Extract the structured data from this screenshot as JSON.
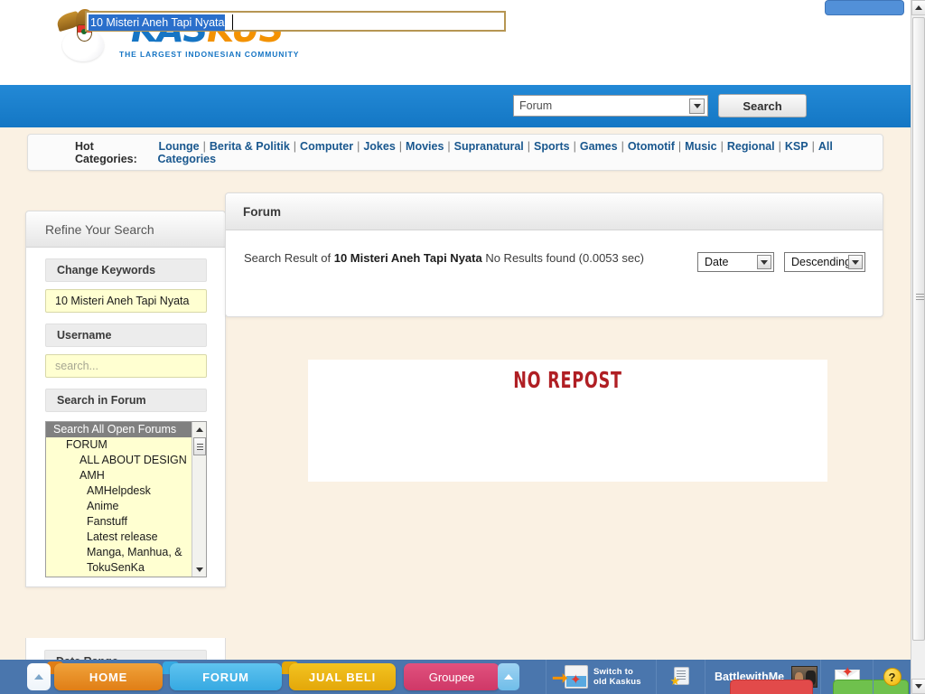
{
  "brand": {
    "name_part1": "KAS",
    "name_part2": "KUS",
    "tagline": "THE LARGEST INDONESIAN COMMUNITY",
    "accent_blue": "#1675c4",
    "accent_orange": "#f39200"
  },
  "search": {
    "query_value": "10 Misteri Aneh Tapi Nyata",
    "type_selected": "Forum",
    "button_label": "Search"
  },
  "hot_categories": {
    "label": "Hot Categories:",
    "items": [
      "Lounge",
      "Berita & Politik",
      "Computer",
      "Jokes",
      "Movies",
      "Supranatural",
      "Sports",
      "Games",
      "Otomotif",
      "Music",
      "Regional",
      "KSP",
      "All Categories"
    ]
  },
  "sidebar": {
    "title": "Refine Your Search",
    "change_keywords_label": "Change Keywords",
    "keywords_value": "10 Misteri Aneh Tapi Nyata",
    "username_label": "Username",
    "username_placeholder": "search...",
    "search_in_forum_label": "Search in Forum",
    "date_range_label": "Date Range",
    "forum_list": [
      {
        "label": "Search All Open Forums",
        "depth": 0,
        "selected": true
      },
      {
        "label": "FORUM",
        "depth": 1,
        "selected": false
      },
      {
        "label": "ALL ABOUT DESIGN",
        "depth": 2,
        "selected": false
      },
      {
        "label": "AMH",
        "depth": 2,
        "selected": false
      },
      {
        "label": "AMHelpdesk",
        "depth": 3,
        "selected": false
      },
      {
        "label": "Anime",
        "depth": 3,
        "selected": false
      },
      {
        "label": "Fanstuff",
        "depth": 3,
        "selected": false
      },
      {
        "label": "Latest release",
        "depth": 3,
        "selected": false
      },
      {
        "label": "Manga, Manhua, &",
        "depth": 3,
        "selected": false
      },
      {
        "label": "TokuSenKa",
        "depth": 3,
        "selected": false
      }
    ]
  },
  "main": {
    "panel_title": "Forum",
    "result_prefix": "Search Result of ",
    "result_query": "10 Misteri Aneh Tapi Nyata",
    "result_suffix": " No Results found (0.0053 sec)",
    "sort_field": "Date",
    "sort_order": "Descending",
    "banner_text": "NO REPOST",
    "banner_color": "#b01f24"
  },
  "taskbar": {
    "tabs": [
      {
        "label": "HOME",
        "color": "#e07e16"
      },
      {
        "label": "FORUM",
        "color": "#36a9e2"
      },
      {
        "label": "JUAL BELI",
        "color": "#e3a70a"
      },
      {
        "label": "Groupee",
        "color": "#cf3867"
      }
    ],
    "switch_line1": "Switch to",
    "switch_line2": "old Kaskus",
    "username": "BattlewithMe",
    "help_glyph": "?"
  }
}
